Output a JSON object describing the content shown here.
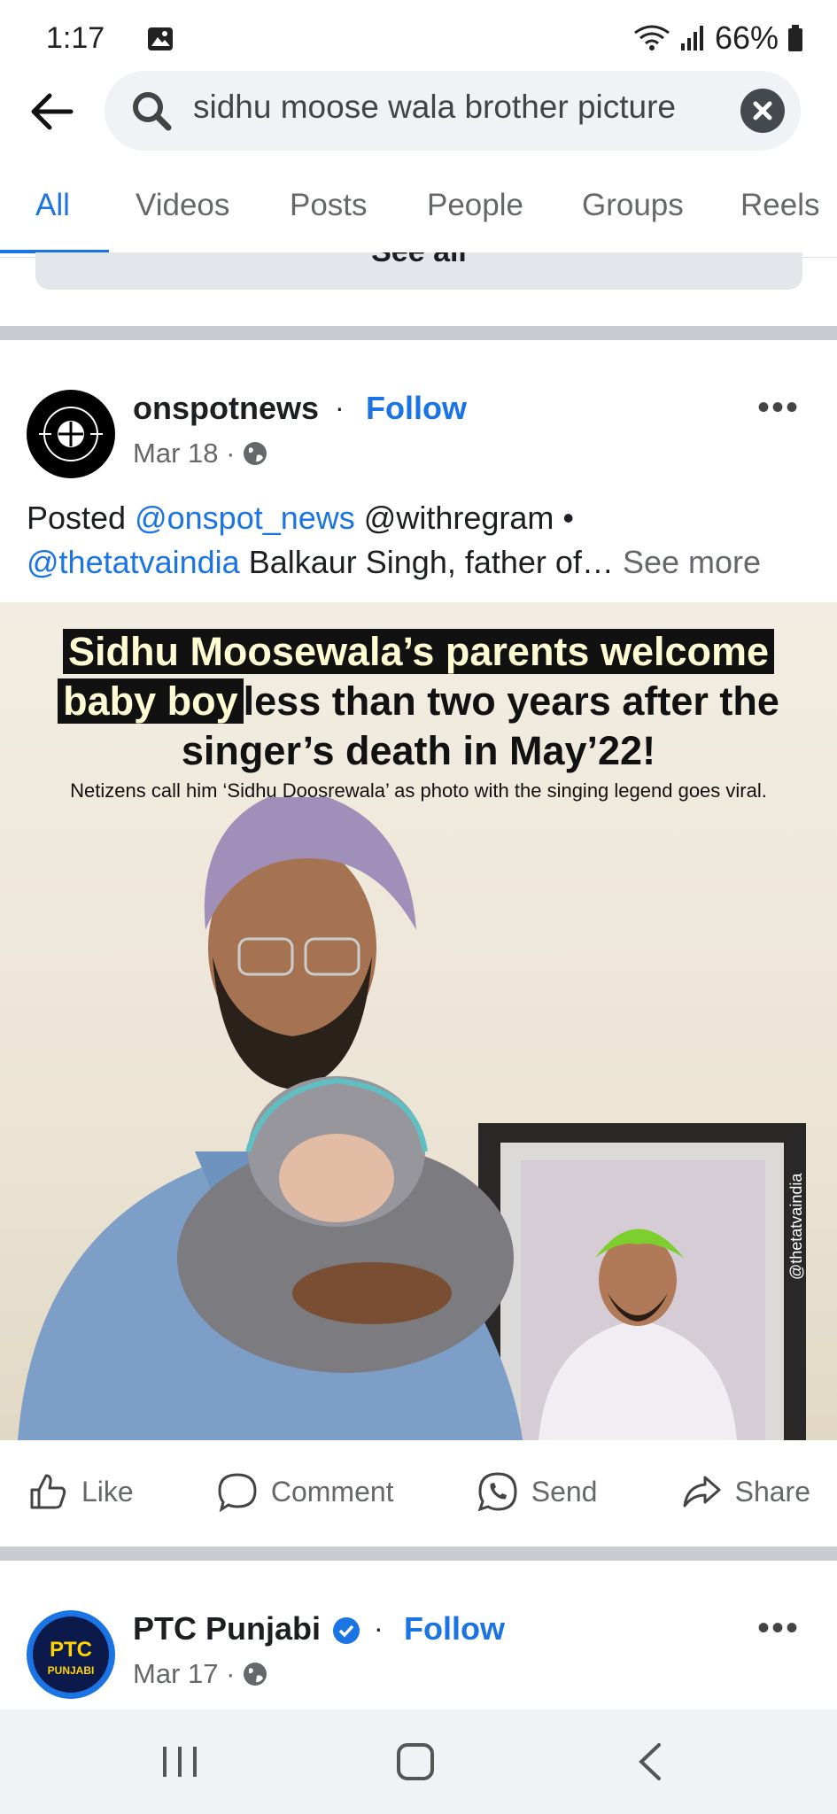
{
  "status": {
    "time": "1:17",
    "battery": "66%"
  },
  "search": {
    "query": "sidhu moose wala brother picture"
  },
  "tabs": [
    {
      "label": "All"
    },
    {
      "label": "Videos"
    },
    {
      "label": "Posts"
    },
    {
      "label": "People"
    },
    {
      "label": "Groups"
    },
    {
      "label": "Reels"
    }
  ],
  "see_all_label": "See all",
  "post1": {
    "author": "onspotnews",
    "separator": "·",
    "follow_label": "Follow",
    "date": "Mar 18 ·",
    "more_label": "•••",
    "caption": {
      "prefix": "Posted ",
      "mention1": "@onspot_news",
      "middle": " @withregram •",
      "mention2": "@thetatvaindia",
      "text": " Balkaur Singh, father of…",
      "see_more": " See more"
    },
    "image": {
      "headline_hl1": "Sidhu Moosewala’s parents welcome",
      "headline_hl2": "baby boy",
      "headline_rest": "less than two years after the",
      "headline_line3": "singer’s death in May’22!",
      "subline": "Netizens call him ‘Sidhu Doosrewala’ as photo with the singing legend goes viral.",
      "watermark": "@thetatvaindia"
    }
  },
  "actions": [
    {
      "label": "Like",
      "icon": "like-icon"
    },
    {
      "label": "Comment",
      "icon": "comment-icon"
    },
    {
      "label": "Send",
      "icon": "whatsapp-icon"
    },
    {
      "label": "Share",
      "icon": "share-icon"
    }
  ],
  "post2": {
    "author": "PTC Punjabi",
    "separator": "·",
    "follow_label": "Follow",
    "date": "Mar 17 ·",
    "more_label": "•••",
    "avatar_text_top": "PTC",
    "avatar_text_bottom": "PUNJABI"
  },
  "colors": {
    "accent": "#1b74e4",
    "text": "#1c1e21",
    "muted": "#65676b",
    "headline_highlight": "#fffbd2"
  }
}
